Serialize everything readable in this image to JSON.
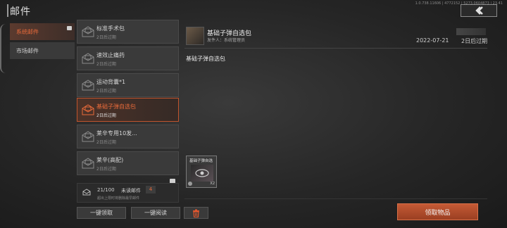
{
  "build_info": "1.0.738.11606 | 4772152 | 5273.0604873 | 23.41",
  "page_title": "邮件",
  "categories": [
    {
      "label": "系统邮件",
      "active": true
    },
    {
      "label": "市场邮件",
      "active": false
    }
  ],
  "mails": [
    {
      "title": "标准手术包",
      "sub": "2日后过期",
      "active": false
    },
    {
      "title": "速效止痛药",
      "sub": "2日后过期",
      "active": false
    },
    {
      "title": "运动背囊*1",
      "sub": "2日后过期",
      "active": false
    },
    {
      "title": "基础子弹自选包",
      "sub": "2日后过期",
      "active": true
    },
    {
      "title": "莱辛专用10发...",
      "sub": "2日后过期",
      "active": false
    },
    {
      "title": "莱辛(高配)",
      "sub": "2日后过期",
      "active": false
    }
  ],
  "footer": {
    "count": "21/100",
    "unread_label": "未读邮件",
    "unread_count": "4",
    "note": "超出上限时将删除最早邮件"
  },
  "actions": {
    "claim_all": "一键领取",
    "read_all": "一键阅读"
  },
  "detail": {
    "title": "基础子弹自选包",
    "sender": "发件人：系统管理员",
    "date": "2022-07-21",
    "expire": "2日后过期",
    "body": "基础子弹自选包",
    "attachment": {
      "name": "基础子弹自选",
      "qty": "X2"
    },
    "claim_button": "领取物品"
  },
  "colors": {
    "accent": "#e86a3a",
    "claim": "#b84e2c"
  }
}
